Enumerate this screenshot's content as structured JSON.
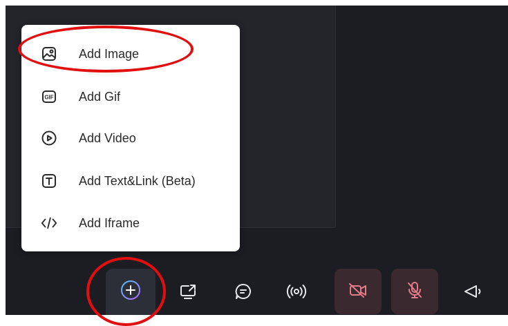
{
  "menu": {
    "items": [
      {
        "label": "Add Image",
        "icon": "image-icon"
      },
      {
        "label": "Add Gif",
        "icon": "gif-icon"
      },
      {
        "label": "Add Video",
        "icon": "video-play-icon"
      },
      {
        "label": "Add Text&Link (Beta)",
        "icon": "text-icon"
      },
      {
        "label": "Add Iframe",
        "icon": "code-icon"
      }
    ]
  },
  "toolbar": {
    "items": [
      {
        "name": "add-content",
        "icon": "plus-circle-icon"
      },
      {
        "name": "share-screen",
        "icon": "screen-share-icon"
      },
      {
        "name": "chat",
        "icon": "chat-icon"
      },
      {
        "name": "broadcast",
        "icon": "broadcast-icon"
      },
      {
        "name": "camera-off",
        "icon": "camera-off-icon"
      },
      {
        "name": "mic-off",
        "icon": "mic-off-icon"
      },
      {
        "name": "announce",
        "icon": "megaphone-icon"
      }
    ]
  },
  "colors": {
    "background": "#1b1d22",
    "panel": "#23252b",
    "menu_bg": "#ffffff",
    "muted_btn": "#3a2a2f",
    "muted_icon": "#e57b8b",
    "annotation": "#e10f0f"
  }
}
